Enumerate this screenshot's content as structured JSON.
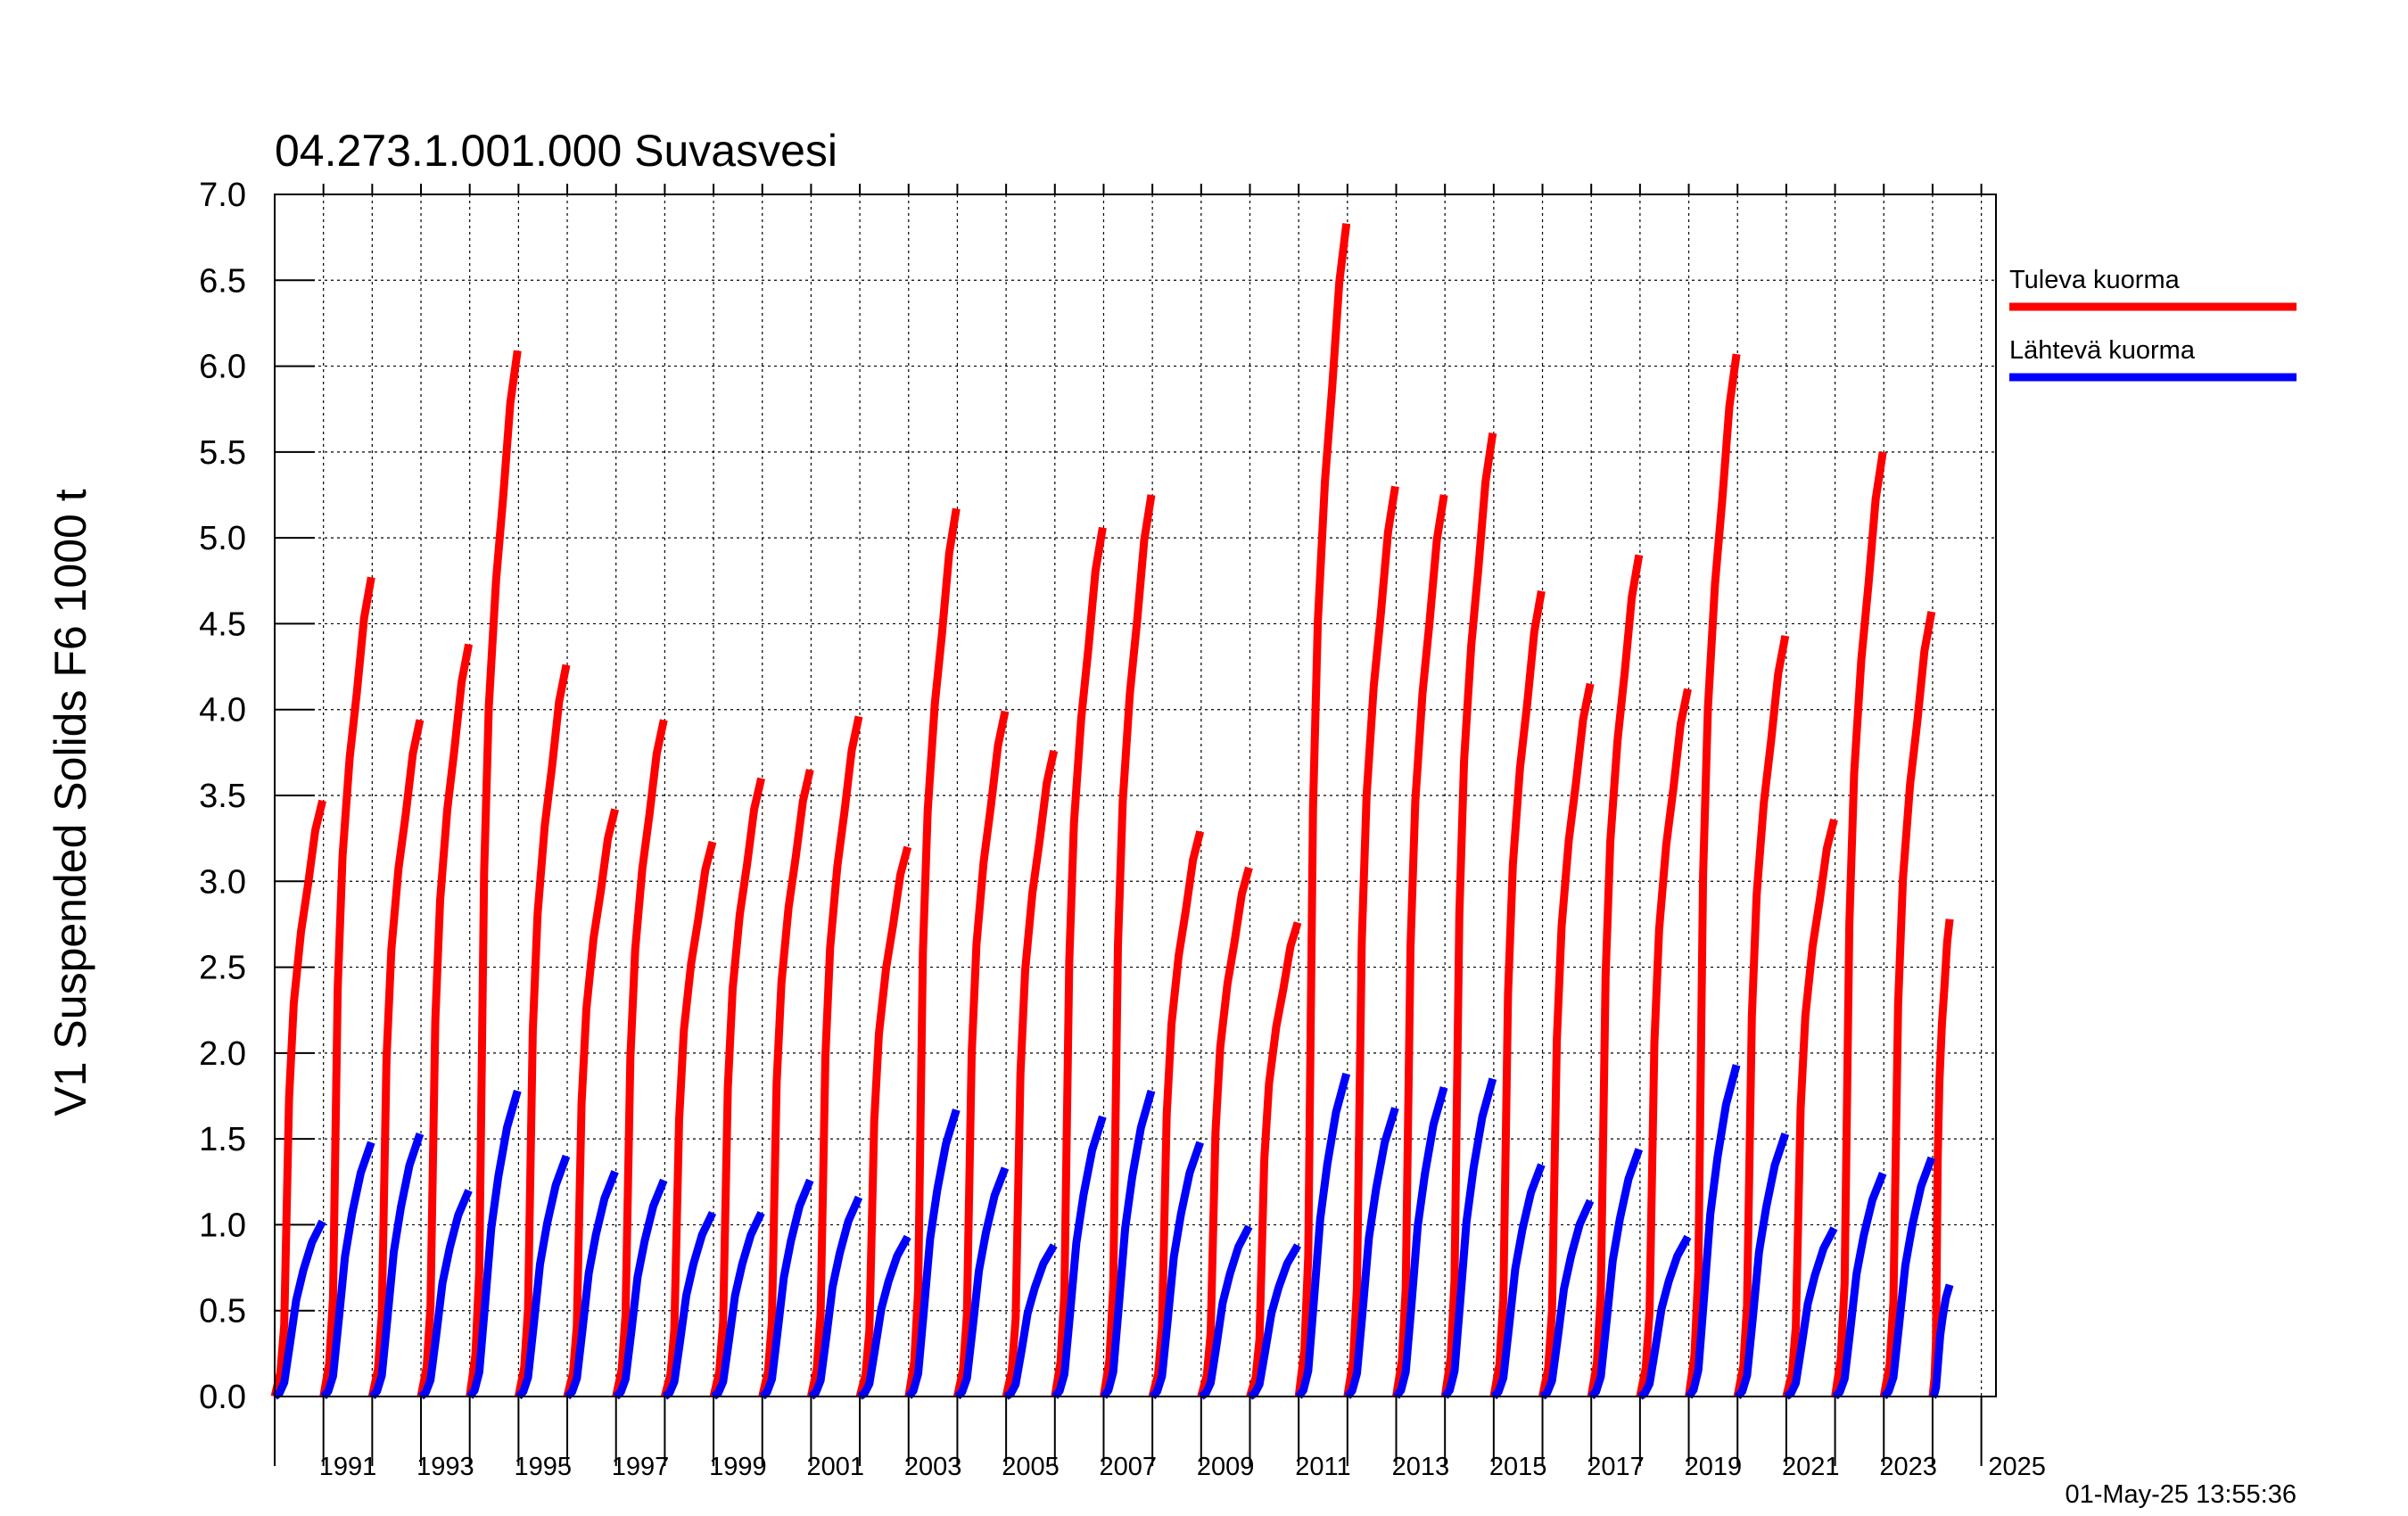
{
  "chart_data": {
    "type": "line",
    "title": "04.273.1.001.000 Suvasvesi",
    "ylabel": "V1 Suspended Solids F6 1000 t",
    "xlabel": "",
    "ylim": [
      0,
      7
    ],
    "xlim": [
      1990,
      2025.3
    ],
    "y_ticks": [
      "0.0",
      "0.5",
      "1.0",
      "1.5",
      "2.0",
      "2.5",
      "3.0",
      "3.5",
      "4.0",
      "4.5",
      "5.0",
      "5.5",
      "6.0",
      "6.5",
      "7.0"
    ],
    "x_ticks": [
      "1991",
      "1993",
      "1995",
      "1997",
      "1999",
      "2001",
      "2003",
      "2005",
      "2007",
      "2009",
      "2011",
      "2013",
      "2015",
      "2017",
      "2019",
      "2021",
      "2023",
      "2025"
    ],
    "grid": true,
    "legend_position": "right",
    "timestamp": "01-May-25 13:55:36",
    "colors": {
      "tuleva": "#ff0000",
      "lahteva": "#0000ff"
    },
    "series": [
      {
        "name": "Tuleva kuorma",
        "color": "#ff0000",
        "annual_totals": [
          {
            "year": 1990,
            "total": 3.47
          },
          {
            "year": 1991,
            "total": 4.77
          },
          {
            "year": 1992,
            "total": 3.94
          },
          {
            "year": 1993,
            "total": 4.38
          },
          {
            "year": 1994,
            "total": 6.09
          },
          {
            "year": 1995,
            "total": 4.26
          },
          {
            "year": 1996,
            "total": 3.42
          },
          {
            "year": 1997,
            "total": 3.94
          },
          {
            "year": 1998,
            "total": 3.23
          },
          {
            "year": 1999,
            "total": 3.6
          },
          {
            "year": 2000,
            "total": 3.65
          },
          {
            "year": 2001,
            "total": 3.96
          },
          {
            "year": 2002,
            "total": 3.2
          },
          {
            "year": 2003,
            "total": 5.17
          },
          {
            "year": 2004,
            "total": 3.99
          },
          {
            "year": 2005,
            "total": 3.76
          },
          {
            "year": 2006,
            "total": 5.06
          },
          {
            "year": 2007,
            "total": 5.25
          },
          {
            "year": 2008,
            "total": 3.29
          },
          {
            "year": 2009,
            "total": 3.08
          },
          {
            "year": 2010,
            "total": 2.76
          },
          {
            "year": 2011,
            "total": 6.83
          },
          {
            "year": 2012,
            "total": 5.3
          },
          {
            "year": 2013,
            "total": 5.25
          },
          {
            "year": 2014,
            "total": 5.61
          },
          {
            "year": 2015,
            "total": 4.69
          },
          {
            "year": 2016,
            "total": 4.15
          },
          {
            "year": 2017,
            "total": 4.9
          },
          {
            "year": 2018,
            "total": 4.12
          },
          {
            "year": 2019,
            "total": 6.07
          },
          {
            "year": 2020,
            "total": 4.43
          },
          {
            "year": 2021,
            "total": 3.36
          },
          {
            "year": 2022,
            "total": 5.5
          },
          {
            "year": 2023,
            "total": 4.57
          },
          {
            "year": 2024,
            "total": 2.78
          }
        ]
      },
      {
        "name": "Lähtevä kuorma",
        "color": "#0000ff",
        "annual_totals": [
          {
            "year": 1990,
            "total": 1.02
          },
          {
            "year": 1991,
            "total": 1.48
          },
          {
            "year": 1992,
            "total": 1.53
          },
          {
            "year": 1993,
            "total": 1.2
          },
          {
            "year": 1994,
            "total": 1.78
          },
          {
            "year": 1995,
            "total": 1.4
          },
          {
            "year": 1996,
            "total": 1.31
          },
          {
            "year": 1997,
            "total": 1.26
          },
          {
            "year": 1998,
            "total": 1.07
          },
          {
            "year": 1999,
            "total": 1.07
          },
          {
            "year": 2000,
            "total": 1.26
          },
          {
            "year": 2001,
            "total": 1.16
          },
          {
            "year": 2002,
            "total": 0.93
          },
          {
            "year": 2003,
            "total": 1.67
          },
          {
            "year": 2004,
            "total": 1.33
          },
          {
            "year": 2005,
            "total": 0.88
          },
          {
            "year": 2006,
            "total": 1.63
          },
          {
            "year": 2007,
            "total": 1.78
          },
          {
            "year": 2008,
            "total": 1.48
          },
          {
            "year": 2009,
            "total": 0.99
          },
          {
            "year": 2010,
            "total": 0.88
          },
          {
            "year": 2011,
            "total": 1.88
          },
          {
            "year": 2012,
            "total": 1.68
          },
          {
            "year": 2013,
            "total": 1.8
          },
          {
            "year": 2014,
            "total": 1.85
          },
          {
            "year": 2015,
            "total": 1.35
          },
          {
            "year": 2016,
            "total": 1.14
          },
          {
            "year": 2017,
            "total": 1.44
          },
          {
            "year": 2018,
            "total": 0.93
          },
          {
            "year": 2019,
            "total": 1.93
          },
          {
            "year": 2020,
            "total": 1.53
          },
          {
            "year": 2021,
            "total": 0.98
          },
          {
            "year": 2022,
            "total": 1.3
          },
          {
            "year": 2023,
            "total": 1.39
          },
          {
            "year": 2024,
            "total": 0.65
          }
        ]
      }
    ]
  }
}
